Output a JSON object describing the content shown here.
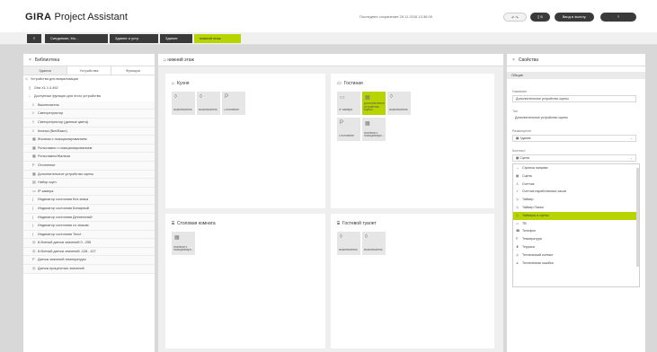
{
  "app": {
    "title_bold": "GIRA",
    "title_rest": " Project Assistant"
  },
  "header": {
    "last_save": "Последнее сохранение 29.11.2016 13:36:09",
    "buttons": [
      "B",
      "Б",
      "Ввод в эксплу.",
      "?"
    ]
  },
  "breadcrumb": [
    "≡",
    "Синдинкин, Мо...",
    "Здание и устр.",
    "Здание",
    "нижний этаж"
  ],
  "library": {
    "title": "Библиотека",
    "tabs": [
      "Здания",
      "Устройства",
      "Функции"
    ],
    "rows": [
      {
        "icon": "⊂",
        "label": "Устройства для визуализации",
        "indent": 2,
        "item": false
      },
      {
        "icon": "▯",
        "label": "Gira X1 1.0.492",
        "indent": 6,
        "item": false
      },
      {
        "icon": "↓",
        "label": "Доступные функции для этого устройства",
        "indent": 6,
        "item": false
      },
      {
        "icon": "◊",
        "label": "Выключатель",
        "indent": 10,
        "item": true
      },
      {
        "icon": "◊",
        "label": "Светорегулятор",
        "indent": 10,
        "item": true
      },
      {
        "icon": "◊",
        "label": "Светорегулятор (данные цвета)",
        "indent": 10,
        "item": true
      },
      {
        "icon": "◊",
        "label": "Кнопка (Вкл/Выкл)",
        "indent": 10,
        "item": true
      },
      {
        "icon": "▦",
        "label": "Жалюзи с позиционированием",
        "indent": 10,
        "item": true
      },
      {
        "icon": "▦",
        "label": "Рольставни с позиционированием",
        "indent": 10,
        "item": true
      },
      {
        "icon": "▦",
        "label": "Рольставни/Жалюзи",
        "indent": 10,
        "item": true
      },
      {
        "icon": "P",
        "label": "Отопление",
        "indent": 10,
        "item": true
      },
      {
        "icon": "▦",
        "label": "Дополнительное устройство сцены",
        "indent": 10,
        "item": true
      },
      {
        "icon": "▤",
        "label": "Набор сцен",
        "indent": 10,
        "item": true
      },
      {
        "icon": "▭",
        "label": "IP камера",
        "indent": 10,
        "item": true
      },
      {
        "icon": "|",
        "label": "Индикатор состояния Без знака",
        "indent": 10,
        "item": true
      },
      {
        "icon": "|",
        "label": "Индикатор состояния Бинарный",
        "indent": 10,
        "item": true
      },
      {
        "icon": "|",
        "label": "Индикатор состояния Десятичный",
        "indent": 10,
        "item": true
      },
      {
        "icon": "|",
        "label": "Индикатор состояния со знаком",
        "indent": 10,
        "item": true
      },
      {
        "icon": "|",
        "label": "Индикатор состояния Текст",
        "indent": 10,
        "item": true
      },
      {
        "icon": "◎",
        "label": "8-битный датчик значений 0...255",
        "indent": 10,
        "item": true
      },
      {
        "icon": "◎",
        "label": "8-битный датчик значений -128...127",
        "indent": 10,
        "item": true
      },
      {
        "icon": "P",
        "label": "Датчик значений температуры",
        "indent": 10,
        "item": true
      },
      {
        "icon": "◎",
        "label": "Датчик процентных значений",
        "indent": 10,
        "item": true
      }
    ]
  },
  "floor": {
    "title": "нижний этаж",
    "rooms": [
      {
        "name": "Кухня",
        "icon": "⌂",
        "tiles": [
          {
            "icon": "◊",
            "label": "Выключатель",
            "hl": false
          },
          {
            "icon": "◊",
            "label": "Выключатель",
            "hl": false
          },
          {
            "icon": "P",
            "label": "Отопление",
            "hl": false
          }
        ]
      },
      {
        "name": "Гостиная",
        "icon": "▭",
        "tiles": [
          {
            "icon": "▭",
            "label": "IP камера",
            "hl": false
          },
          {
            "icon": "▦",
            "label": "Дополнительное устройство сцены",
            "hl": true
          },
          {
            "icon": "◊",
            "label": "Выключатель",
            "hl": false
          },
          {
            "icon": "P",
            "label": "Отопление",
            "hl": false
          },
          {
            "icon": "▦",
            "label": "Жалюзи с позициониро...",
            "hl": false
          }
        ]
      },
      {
        "name": "Столовая комната",
        "icon": "⌸",
        "tiles": [
          {
            "icon": "▦",
            "label": "Жалюзи с позициониро...",
            "hl": false
          }
        ]
      },
      {
        "name": "Гостевой туалет",
        "icon": "⌸",
        "tiles": [
          {
            "icon": "◊",
            "label": "Выключатель",
            "hl": false
          },
          {
            "icon": "◊",
            "label": "Выключатель",
            "hl": false
          }
        ]
      }
    ]
  },
  "properties": {
    "title": "Свойства",
    "section": "Общие",
    "name_label": "Название",
    "name_value": "Дополнительное устройство сцены",
    "type_label": "Тип",
    "type_value": "Дополнительное устройство сцены",
    "location_label": "Размещение",
    "location_value": "Здание",
    "context_label": "Контекст",
    "context_value": "Сцена",
    "options": [
      {
        "icon": "↔",
        "label": "Стрелка направо",
        "sel": false
      },
      {
        "icon": "▦",
        "label": "Сцена",
        "sel": false
      },
      {
        "icon": "♙",
        "label": "Счетчик",
        "sel": false
      },
      {
        "icon": "◑",
        "label": "Счетчик наработанных часов",
        "sel": false
      },
      {
        "icon": "◷",
        "label": "Таймер",
        "sel": false
      },
      {
        "icon": "◷",
        "label": "Таймер Папка",
        "sel": false
      },
      {
        "icon": "◷",
        "label": "Таймеры и сцены",
        "sel": true
      },
      {
        "icon": "▭",
        "label": "ТВ",
        "sel": false
      },
      {
        "icon": "☎",
        "label": "Телефон",
        "sel": false
      },
      {
        "icon": "P",
        "label": "Температура",
        "sel": false
      },
      {
        "icon": "♜",
        "label": "Терраса",
        "sel": false
      },
      {
        "icon": "◎",
        "label": "Технический контакт",
        "sel": false
      },
      {
        "icon": "∡",
        "label": "Техническая ошибка",
        "sel": false
      }
    ]
  }
}
